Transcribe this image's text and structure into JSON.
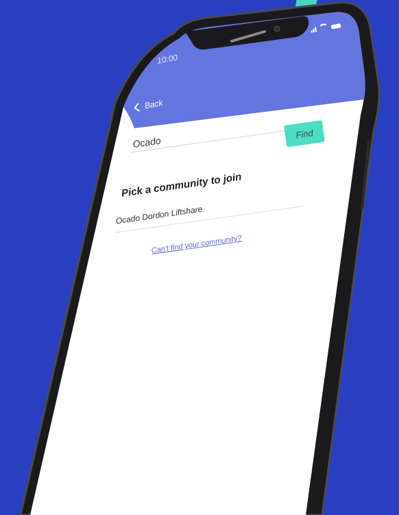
{
  "status_bar": {
    "time": "10:00"
  },
  "nav": {
    "back_label": "Back"
  },
  "search": {
    "value": "Ocado",
    "button_label": "Find"
  },
  "section": {
    "heading": "Pick a community to join"
  },
  "communities": [
    {
      "name": "Ocado Dordon Liftshare"
    }
  ],
  "footer_link": {
    "label": "Can't find your community?"
  },
  "colors": {
    "background": "#2a3ec2",
    "header": "#6475df",
    "accent": "#4cddc2",
    "link": "#5d6bd6"
  },
  "icons": [
    "chevron-left-icon",
    "signal-icon",
    "wifi-icon",
    "battery-icon"
  ]
}
